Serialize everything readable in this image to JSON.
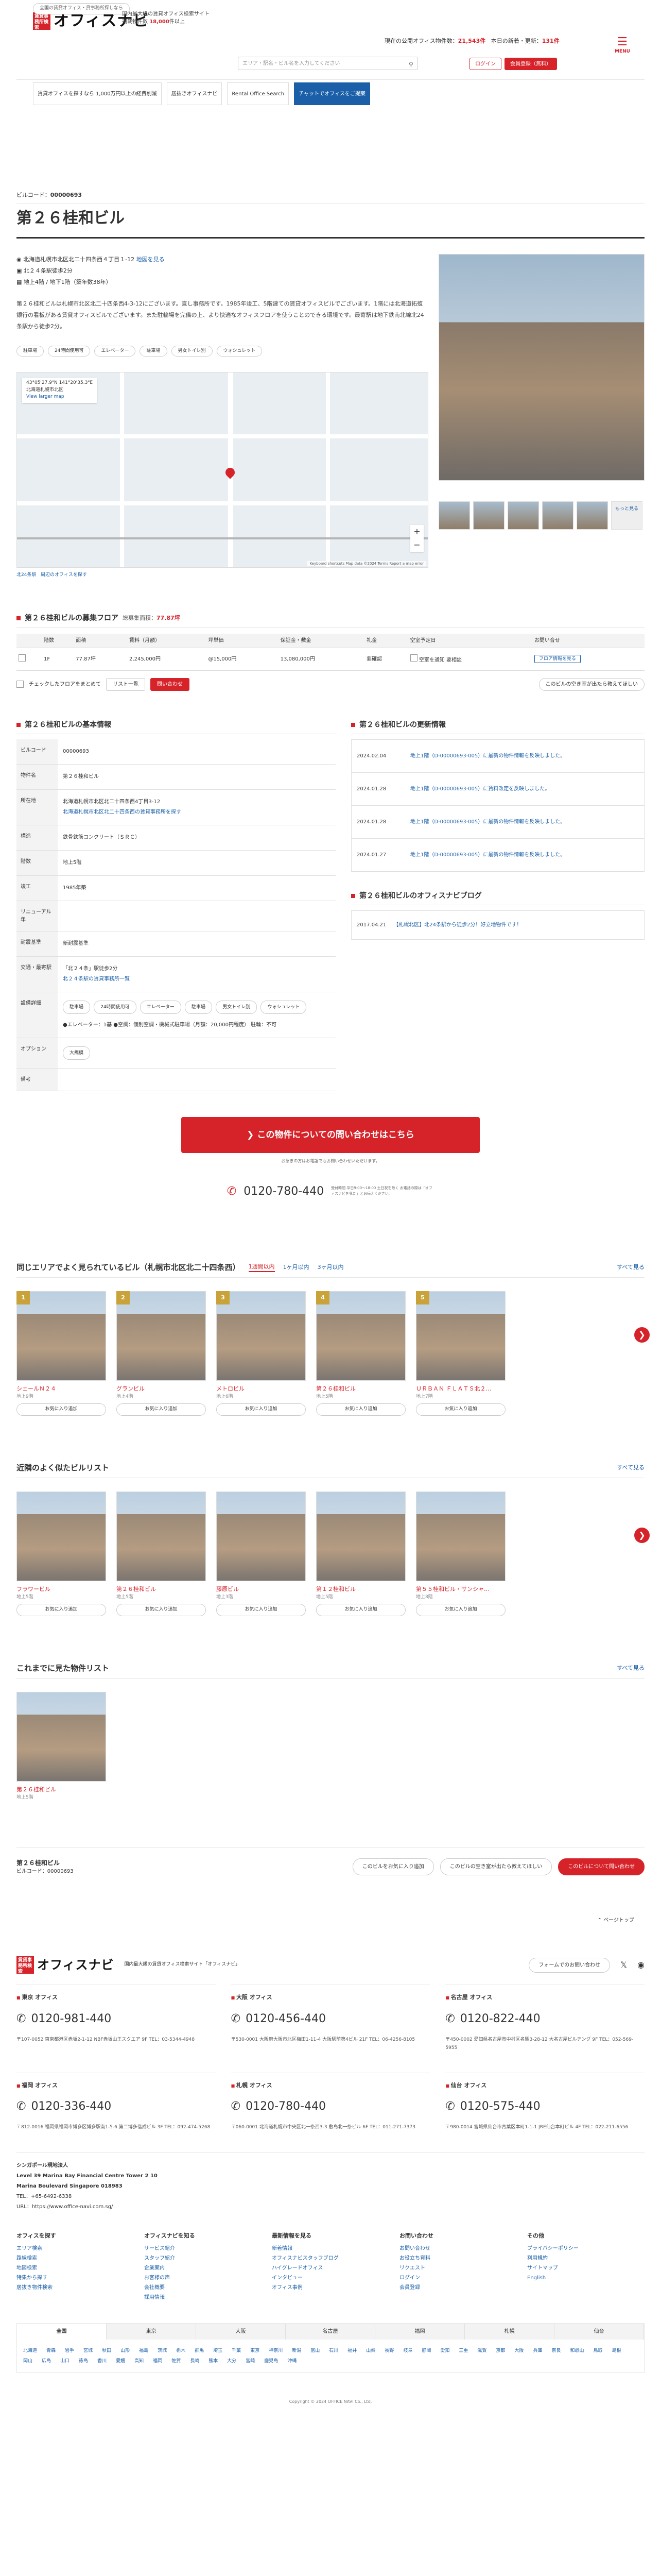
{
  "header": {
    "tagline": "全国の賃貸オフィス・貸事務所探しなら",
    "logo_box": "賃貸事務所検索",
    "logo_text": "オフィスナビ",
    "info_line1": "国内最大級の賃貸オフィス検索サイト",
    "info_line2": "掲載物件数",
    "info_count": "18,000",
    "info_unit": "件以上",
    "count_label": "現在の公開オフィス物件数：",
    "count_value": "21,543件",
    "new_label": "本日の新着・更新：",
    "new_value": "131件",
    "search_placeholder": "エリア・駅名・ビル名を入力してください",
    "login": "ログイン",
    "register": "会員登録（無料）",
    "menu": "MENU"
  },
  "banners": [
    {
      "text": "賃貸オフィスを探すなら 1,000万円以上の経費削減"
    },
    {
      "text": "居抜きオフィスナビ"
    },
    {
      "text": "Rental Office Search"
    },
    {
      "text": "チャットでオフィスをご提案"
    }
  ],
  "building": {
    "code_label": "ビルコード：",
    "code": "00000693",
    "name": "第２６桂和ビル",
    "address": "北海道札幌市北区北二十四条西４丁目１-12",
    "map_link": "地図を見る",
    "station1": "北２４条駅徒歩2分",
    "station2": "地上4階 / 地下1階（築年数38年）",
    "description": "第２６桂和ビルは札幌市北区北二十四条西4-3-12にございます。",
    "description2": "直し事務所です。1985年竣工、5階建ての賃貸オフィスビルでございます。1階には北海道拓殖銀行の看板がある賃貸オフィスビルでございます。また駐輪場を完備の上、より快適なオフィスフロアを使うことのできる環境です。最寄駅は地下鉄南北線北24条駅から徒歩2分。",
    "tags": [
      "駐車場",
      "24時間使用可",
      "エレベーター",
      "駐車場",
      "男女トイレ別",
      "ウォシュレット"
    ]
  },
  "map": {
    "coord": "43°05'27.9\"N 141°20'35.3\"E",
    "coord_sub": "北海道札幌市北区",
    "larger": "View larger map",
    "credit": "Keyboard shortcuts  Map data ©2024  Terms  Report a map error",
    "link1": "北24条駅",
    "link2": "周辺のオフィスを探す"
  },
  "photos": {
    "more": "もっと見る"
  },
  "vacancy": {
    "title": "第２６桂和ビルの募集フロア",
    "sub_label": "総募集面積：",
    "sub_value": "77.87坪",
    "headers": [
      "階数",
      "面積",
      "賃料（月額）",
      "坪単価",
      "保証金・敷金",
      "礼金",
      "空室予定日",
      "お問い合せ"
    ],
    "row": [
      "1F",
      "77.87坪",
      "2,245,000円",
      "@15,000円",
      "13,080,000円",
      "要確認",
      "要相談",
      "フロア情報を見る"
    ],
    "check": "空室を通知",
    "check_all": "チェックしたフロアをまとめて",
    "list_btn": "リスト一覧",
    "inquiry_btn": "問い合わせ",
    "right_btn": "このビルの空き室が出たら教えてほしい"
  },
  "info": {
    "title": "第２６桂和ビルの基本情報",
    "rows": [
      {
        "k": "ビルコード",
        "v": "00000693"
      },
      {
        "k": "物件名",
        "v": "第２６桂和ビル"
      },
      {
        "k": "所在地",
        "v": "北海道札幌市北区北二十四条西4丁目3-12"
      },
      {
        "k": "構造",
        "v": "鉄骨鉄筋コンクリート（ＳＲＣ）"
      },
      {
        "k": "階数",
        "v": "地上5階"
      },
      {
        "k": "竣工",
        "v": "1985年築"
      },
      {
        "k": "リニューアル年",
        "v": ""
      },
      {
        "k": "耐震基準",
        "v": "新耐震基準"
      },
      {
        "k": "交通・最寄駅",
        "v": "「北２４条」駅徒歩2分"
      },
      {
        "k": "設備詳細",
        "v": ""
      },
      {
        "k": "オプション",
        "v": "大規模"
      },
      {
        "k": "備考",
        "v": ""
      }
    ],
    "addr_link": "北海道札幌市北区北二十四条西の賃貸事務所を探す",
    "station_link": "北２４条駅の賃貸事務所一覧",
    "equip_tags": [
      "駐車場",
      "24時間使用可",
      "エレベーター",
      "駐車場",
      "男女トイレ別",
      "ウォシュレット"
    ],
    "equip_text": "●エレベーター：1基 ●空調：個別空調・機械式駐車場（月額：20,000円程度） 駐輪：不可"
  },
  "history": {
    "title": "第２６桂和ビルの更新情報",
    "rows": [
      {
        "d": "2024.02.04",
        "t": "地上1階（D-00000693-005）に最新の物件情報を反映しました。"
      },
      {
        "d": "2024.01.28",
        "t": "地上1階（D-00000693-005）に賃料改定を反映しました。"
      },
      {
        "d": "2024.01.28",
        "t": "地上1階（D-00000693-005）に最新の物件情報を反映しました。"
      },
      {
        "d": "2024.01.27",
        "t": "地上1階（D-00000693-005）に最新の物件情報を反映しました。"
      }
    ],
    "blog_title": "第２６桂和ビルのオフィスナビブログ",
    "blog_date": "2017.04.21",
    "blog_text": "【札幌北区】北24条駅から徒歩2分！好立地物件です！"
  },
  "cta": {
    "main": "この物件についての問い合わせはこちら",
    "note": "お急ぎの方はお電話でもお問い合わせいただけます。",
    "tel": "0120-780-440",
    "tel_note": "受付時間 平日9:00〜18:00 土日祝を除く お電話の際は「オフィスナビを見た」とお伝えください。"
  },
  "popular": {
    "title": "同じエリアでよく見られているビル（札幌市北区北二十四条西）",
    "tabs": [
      "1週間以内",
      "1ヶ月以内",
      "3ヶ月以内"
    ],
    "more": "すべて見る",
    "cards": [
      {
        "rank": "1",
        "name": "シェールＮ２４",
        "sub": "地上9階"
      },
      {
        "rank": "2",
        "name": "グランビル",
        "sub": "地上4階"
      },
      {
        "rank": "3",
        "name": "メトロビル",
        "sub": "地上6階"
      },
      {
        "rank": "4",
        "name": "第２６桂和ビル",
        "sub": "地上5階"
      },
      {
        "rank": "5",
        "name": "ＵＲＢＡＮ ＦＬＡＴＳ北２…",
        "sub": "地上7階"
      }
    ],
    "fav": "お気に入り追加"
  },
  "nearby": {
    "title": "近隣のよく似たビルリスト",
    "more": "すべて見る",
    "cards": [
      {
        "name": "フラワービル",
        "sub": "地上5階"
      },
      {
        "name": "第２６桂和ビル",
        "sub": "地上5階"
      },
      {
        "name": "藤原ビル",
        "sub": "地上3階"
      },
      {
        "name": "第１２桂和ビル",
        "sub": "地上5階"
      },
      {
        "name": "第５５桂和ビル・サンシャ…",
        "sub": "地上8階"
      }
    ]
  },
  "recent": {
    "title": "これまでに見た物件リスト",
    "more": "すべて見る",
    "cards": [
      {
        "name": "第２６桂和ビル",
        "sub": "地上5階"
      }
    ]
  },
  "sticky": {
    "name": "第２６桂和ビル",
    "code": "ビルコード：00000693",
    "fav": "このビルをお気に入り追加",
    "notify": "このビルの空き室が出たら教えてほしい",
    "inquiry": "このビルについて問い合わせ"
  },
  "pagetop": "ページトップ",
  "footer": {
    "desc": "国内最大級の賃貸オフィス検索サイト「オフィスナビ」",
    "form_btn": "フォームでのお問い合わせ",
    "offices": [
      {
        "n": "東京 オフィス",
        "tel": "0120-981-440",
        "ad": "〒107-0052 東京都港区赤坂2-1-12 NBF赤坂山王スクエア 9F TEL：03-5344-4948"
      },
      {
        "n": "大阪 オフィス",
        "tel": "0120-456-440",
        "ad": "〒530-0001 大阪府大阪市北区梅田1-11-4 大阪駅前第4ビル 21F TEL：06-4256-8105"
      },
      {
        "n": "名古屋 オフィス",
        "tel": "0120-822-440",
        "ad": "〒450-0002 愛知県名古屋市中村区名駅3-28-12 大名古屋ビルヂング 9F TEL：052-569-5955"
      },
      {
        "n": "福岡 オフィス",
        "tel": "0120-336-440",
        "ad": "〒812-0016 福岡県福岡市博多区博多駅南1-5-6 第二博多偕成ビル 3F TEL：092-474-5268"
      },
      {
        "n": "札幌 オフィス",
        "tel": "0120-780-440",
        "ad": "〒060-0001 北海道札幌市中央区北一条西3-3 敷島北一条ビル 6F TEL：011-271-7373"
      },
      {
        "n": "仙台 オフィス",
        "tel": "0120-575-440",
        "ad": "〒980-0014 宮城県仙台市青葉区本町1-1-1 JRE仙台本町ビル 4F TEL：022-211-6556"
      }
    ],
    "sg_title": "シンガポール現地法人",
    "sg_lines": [
      "Level 39 Marina Bay Financial Centre Tower 2 10",
      "Marina Boulevard Singapore 018983",
      "TEL：+65-6492-6338",
      "URL：https://www.office-navi.com.sg/"
    ],
    "nav": [
      {
        "h": "オフィスを探す",
        "items": [
          "エリア検索",
          "路線検索",
          "地図検索",
          "特集から探す",
          "居抜き物件検索"
        ]
      },
      {
        "h": "オフィスナビを知る",
        "items": [
          "サービス紹介",
          "スタッフ紹介",
          "企業案内",
          "お客様の声",
          "会社概要",
          "採用情報"
        ]
      },
      {
        "h": "最新情報を見る",
        "items": [
          "新着情報",
          "オフィスナビスタッフブログ",
          "ハイグレードオフィス",
          "インタビュー",
          "オフィス事例"
        ]
      },
      {
        "h": "お問い合わせ",
        "items": [
          "お問い合わせ",
          "お役立ち資料",
          "リクエスト",
          "ログイン",
          "会員登録"
        ]
      },
      {
        "h": "その他",
        "items": [
          "プライバシーポリシー",
          "利用規約",
          "サイトマップ",
          "English"
        ]
      }
    ],
    "area_tabs": [
      "全国",
      "東京",
      "大阪",
      "名古屋",
      "福岡",
      "札幌",
      "仙台"
    ],
    "cities": [
      "北海道",
      "青森",
      "岩手",
      "宮城",
      "秋田",
      "山形",
      "福島",
      "茨城",
      "栃木",
      "群馬",
      "埼玉",
      "千葉",
      "東京",
      "神奈川",
      "新潟",
      "富山",
      "石川",
      "福井",
      "山梨",
      "長野",
      "岐阜",
      "静岡",
      "愛知",
      "三重",
      "滋賀",
      "京都",
      "大阪",
      "兵庫",
      "奈良",
      "和歌山",
      "鳥取",
      "島根",
      "岡山",
      "広島",
      "山口",
      "徳島",
      "香川",
      "愛媛",
      "高知",
      "福岡",
      "佐賀",
      "長崎",
      "熊本",
      "大分",
      "宮崎",
      "鹿児島",
      "沖縄"
    ],
    "copyright": "Copyright © 2024 OFFICE NAVI Co., Ltd."
  }
}
